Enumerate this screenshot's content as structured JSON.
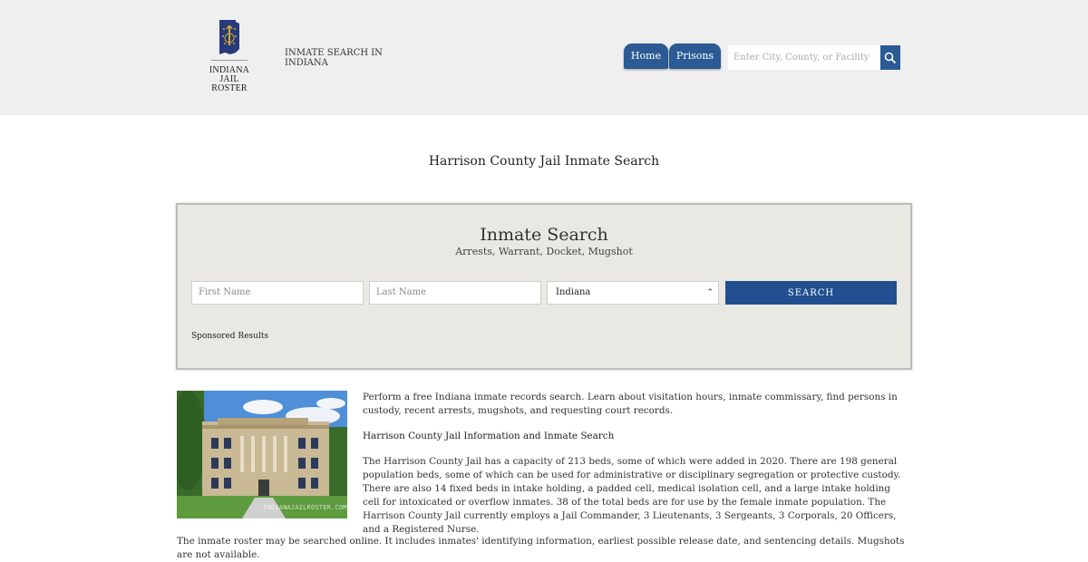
{
  "header": {
    "logo_line1": "INDIANA",
    "logo_line2": "JAIL ROSTER",
    "tagline": "INMATE SEARCH IN INDIANA",
    "nav": [
      {
        "label": "Home"
      },
      {
        "label": "Prisons"
      }
    ],
    "search_placeholder": "Enter City, County, or Facility",
    "brand_color": "#2b5a94",
    "search_icon": "magnifier-icon"
  },
  "page": {
    "title": "Harrison County Jail Inmate Search"
  },
  "search_panel": {
    "title": "Inmate Search",
    "subtitle": "Arrests, Warrant, Docket, Mugshot",
    "first_name_placeholder": "First Name",
    "last_name_placeholder": "Last Name",
    "state_selected": "Indiana",
    "submit_label": "SEARCH",
    "sponsored_label": "Sponsored Results"
  },
  "content": {
    "photo_watermark": "INDIANAJAILROSTER.COM",
    "intro": "Perform a free Indiana inmate records search. Learn about visitation hours, inmate commissary, find persons in custody, recent arrests, mugshots, and requesting court records.",
    "heading": "Harrison County Jail Information and Inmate Search",
    "body": "The Harrison County Jail has a capacity of 213 beds, some of which were added in 2020. There are 198 general population beds, some of which can be used for administrative or disciplinary segregation or protective custody. There are also 14 fixed beds in intake holding, a padded cell, medical isolation cell, and a large intake holding cell for intoxicated or overflow inmates. 38 of the total beds are for use by the female inmate population. The Harrison County Jail currently employs a Jail Commander, 3 Lieutenants, 3 Sergeants, 3 Corporals, 20 Officers, and a Registered Nurse.",
    "roster_note": "The inmate roster may be searched online. It includes inmates' identifying information, earliest possible release date, and sentencing details. Mugshots are not available."
  }
}
